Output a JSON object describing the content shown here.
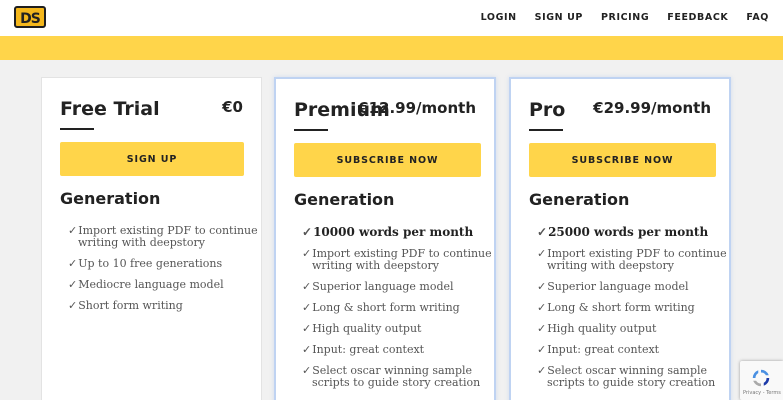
{
  "header": {
    "logo_text": "DS",
    "nav": [
      "LOGIN",
      "SIGN UP",
      "PRICING",
      "FEEDBACK",
      "FAQ"
    ]
  },
  "plans": [
    {
      "name": "Free Trial",
      "price": "€0",
      "cta": "SIGN UP",
      "section": "Generation",
      "features": [
        {
          "text": "Import existing PDF to continue writing with deepstory",
          "strong": false
        },
        {
          "text": "Up to 10 free generations",
          "strong": false
        },
        {
          "text": "Mediocre language model",
          "strong": false
        },
        {
          "text": "Short form writing",
          "strong": false
        }
      ]
    },
    {
      "name": "Premium",
      "price": "€12.99/month",
      "cta": "SUBSCRIBE NOW",
      "section": "Generation",
      "features": [
        {
          "text": "10000 words per month",
          "strong": true
        },
        {
          "text": "Import existing PDF to continue writing with deepstory",
          "strong": false
        },
        {
          "text": "Superior language model",
          "strong": false
        },
        {
          "text": "Long & short form writing",
          "strong": false
        },
        {
          "text": "High quality output",
          "strong": false
        },
        {
          "text": "Input: great context",
          "strong": false
        },
        {
          "text": "Select oscar winning sample scripts to guide story creation",
          "strong": false
        }
      ]
    },
    {
      "name": "Pro",
      "price": "€29.99/month",
      "cta": "SUBSCRIBE NOW",
      "section": "Generation",
      "features": [
        {
          "text": "25000 words per month",
          "strong": true
        },
        {
          "text": "Import existing PDF to continue writing with deepstory",
          "strong": false
        },
        {
          "text": "Superior language model",
          "strong": false
        },
        {
          "text": "Long & short form writing",
          "strong": false
        },
        {
          "text": "High quality output",
          "strong": false
        },
        {
          "text": "Input: great context",
          "strong": false
        },
        {
          "text": "Select oscar winning sample scripts to guide story creation",
          "strong": false
        }
      ]
    }
  ],
  "recaptcha": {
    "text": "Privacy - Terms"
  },
  "colors": {
    "accent": "#ffd54a",
    "highlight_border": "#bfd3f2",
    "text": "#222222"
  },
  "check_symbol": "✓"
}
